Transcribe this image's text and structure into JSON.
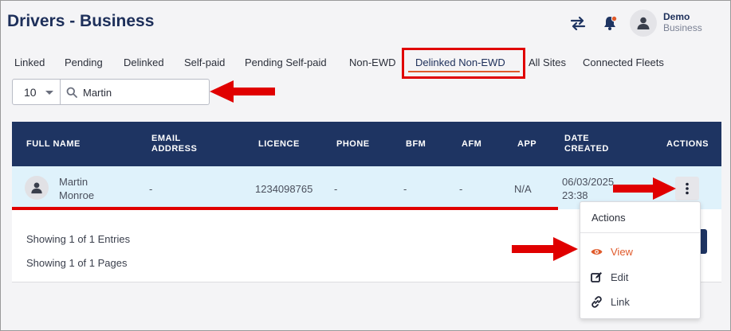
{
  "header": {
    "title": "Drivers - Business",
    "user_name": "Demo",
    "user_role": "Business",
    "icons": [
      "swap-icon",
      "bell-icon",
      "user-avatar-icon"
    ],
    "notification_dot_color": "#e05a2b"
  },
  "tabs": [
    {
      "label": "Linked"
    },
    {
      "label": "Pending"
    },
    {
      "label": "Delinked"
    },
    {
      "label": "Self-paid"
    },
    {
      "label": "Pending Self-paid"
    },
    {
      "label": "Non-EWD"
    },
    {
      "label": "Delinked Non-EWD",
      "active": true
    },
    {
      "label": "All Sites"
    },
    {
      "label": "Connected Fleets"
    }
  ],
  "filters": {
    "page_size": "10",
    "search_value": "Martin"
  },
  "table": {
    "headers": {
      "full_name": "FULL NAME",
      "email_1": "EMAIL",
      "email_2": "ADDRESS",
      "licence": "LICENCE",
      "phone": "PHONE",
      "bfm": "BFM",
      "afm": "AFM",
      "app": "APP",
      "date_1": "DATE",
      "date_2": "CREATED",
      "actions": "ACTIONS"
    },
    "rows": [
      {
        "name_1": "Martin",
        "name_2": "Monroe",
        "email": "-",
        "licence": "1234098765",
        "phone": "-",
        "bfm": "-",
        "afm": "-",
        "app": "N/A",
        "date_1": "06/03/2025",
        "date_2": "23:38"
      }
    ]
  },
  "footer": {
    "entries": "Showing 1 of 1 Entries",
    "pages": "Showing 1 of 1 Pages"
  },
  "actions_menu": {
    "title": "Actions",
    "items": [
      {
        "label": "View",
        "icon": "eye-icon",
        "color": "#e05a2b"
      },
      {
        "label": "Edit",
        "icon": "edit-icon"
      },
      {
        "label": "Link",
        "icon": "link-icon"
      }
    ]
  },
  "colors": {
    "brand_navy": "#1e3462",
    "accent_orange": "#e05a2b",
    "annotation_red": "#e00000",
    "row_highlight": "#dff2fb"
  }
}
